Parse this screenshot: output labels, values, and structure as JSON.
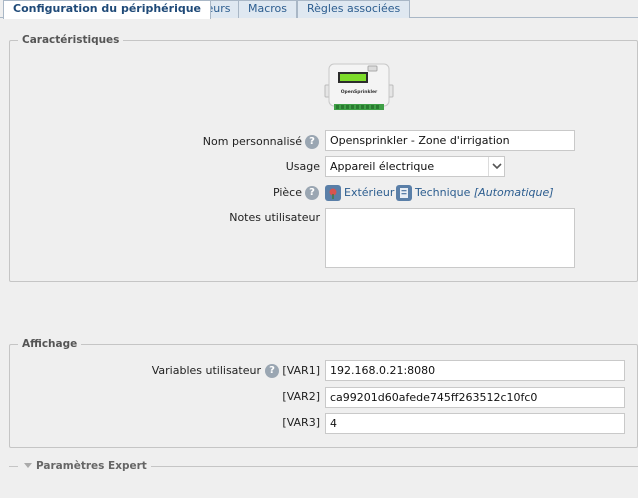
{
  "tabs": [
    {
      "label": "Configuration du périphérique",
      "active": true
    },
    {
      "label": "Valeurs",
      "active": false
    },
    {
      "label": "Macros",
      "active": false
    },
    {
      "label": "Règles associées",
      "active": false
    }
  ],
  "characteristics": {
    "legend": "Caractéristiques",
    "device_brand": "OpenSprinkler",
    "name_label": "Nom personnalisé",
    "name_value": "Opensprinkler - Zone d'irrigation",
    "usage_label": "Usage",
    "usage_value": "Appareil électrique",
    "room_label": "Pièce",
    "room_primary": "Extérieur",
    "room_secondary": "Technique",
    "room_secondary_suffix": "[Automatique]",
    "notes_label": "Notes utilisateur",
    "notes_value": ""
  },
  "display": {
    "legend": "Affichage",
    "vars_label": "Variables utilisateur",
    "vars": [
      {
        "key": "[VAR1]",
        "value": "192.168.0.21:8080"
      },
      {
        "key": "[VAR2]",
        "value": "ca99201d60afede745ff263512c10fc0"
      },
      {
        "key": "[VAR3]",
        "value": "4"
      }
    ]
  },
  "expert": {
    "legend": "Paramètres Expert"
  },
  "colors": {
    "tab_active_text": "#1f4a78",
    "link": "#2c5d8f",
    "help_icon": "#9aa6b2",
    "exterior_icon": "#c0504d",
    "technique_icon": "#5a7fa8"
  }
}
